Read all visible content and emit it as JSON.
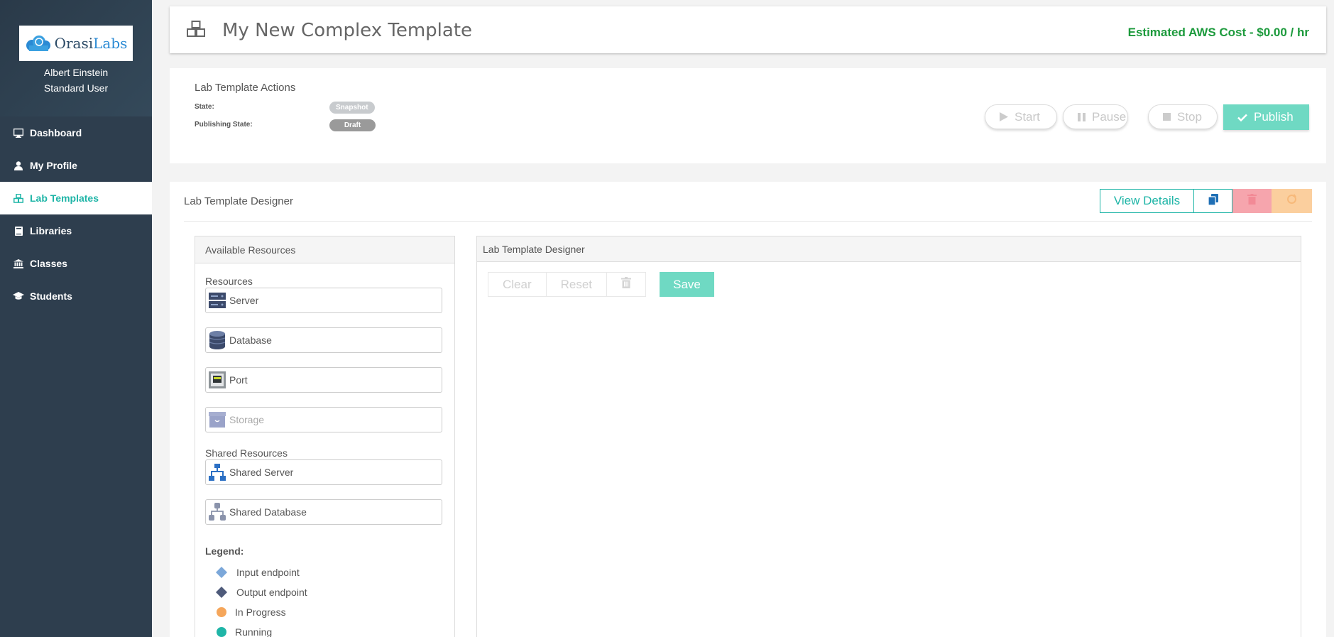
{
  "sidebar": {
    "logo": {
      "text_main": "Orasi",
      "text_accent": "Labs"
    },
    "user": {
      "name": "Albert Einstein",
      "role": "Standard User"
    },
    "items": [
      {
        "label": "Dashboard",
        "icon": "monitor-icon",
        "active": false
      },
      {
        "label": "My Profile",
        "icon": "user-icon",
        "active": false
      },
      {
        "label": "Lab Templates",
        "icon": "cubes-icon",
        "active": true
      },
      {
        "label": "Libraries",
        "icon": "book-icon",
        "active": false
      },
      {
        "label": "Classes",
        "icon": "institution-icon",
        "active": false
      },
      {
        "label": "Students",
        "icon": "graduation-cap-icon",
        "active": false
      }
    ]
  },
  "header": {
    "title": "My New Complex Template",
    "cost": "Estimated AWS Cost - $0.00 / hr",
    "icon": "cubes-icon"
  },
  "actions": {
    "heading": "Lab Template Actions",
    "state_label": "State:",
    "state_value": "Snapshot",
    "publishing_label": "Publishing State:",
    "publishing_value": "Draft",
    "buttons": {
      "start": "Start",
      "pause": "Pause",
      "stop": "Stop",
      "publish": "Publish"
    }
  },
  "designer": {
    "heading": "Lab Template Designer",
    "view_details": "View Details",
    "resources_panel": {
      "title": "Available Resources",
      "resources_label": "Resources",
      "resources": [
        {
          "label": "Server",
          "icon": "server-icon"
        },
        {
          "label": "Database",
          "icon": "database-icon"
        },
        {
          "label": "Port",
          "icon": "port-icon"
        },
        {
          "label": "Storage",
          "icon": "storage-icon"
        }
      ],
      "shared_label": "Shared Resources",
      "shared": [
        {
          "label": "Shared Server",
          "icon": "shared-server-icon"
        },
        {
          "label": "Shared Database",
          "icon": "shared-database-icon"
        }
      ],
      "legend_title": "Legend:",
      "legend": [
        {
          "label": "Input endpoint",
          "color": "#7ba7d9"
        },
        {
          "label": "Output endpoint",
          "color": "#4e5a7a"
        },
        {
          "label": "In Progress",
          "color": "#f5a65b"
        },
        {
          "label": "Running",
          "color": "#1fb5a7"
        }
      ]
    },
    "canvas_panel": {
      "title": "Lab Template Designer",
      "clear": "Clear",
      "reset": "Reset",
      "save": "Save"
    }
  },
  "colors": {
    "sidebar_bg": "#2e3e4e",
    "accent": "#1fb5a7",
    "cost_green": "#1c9a3c",
    "publish_bg": "#6fd9c3"
  }
}
